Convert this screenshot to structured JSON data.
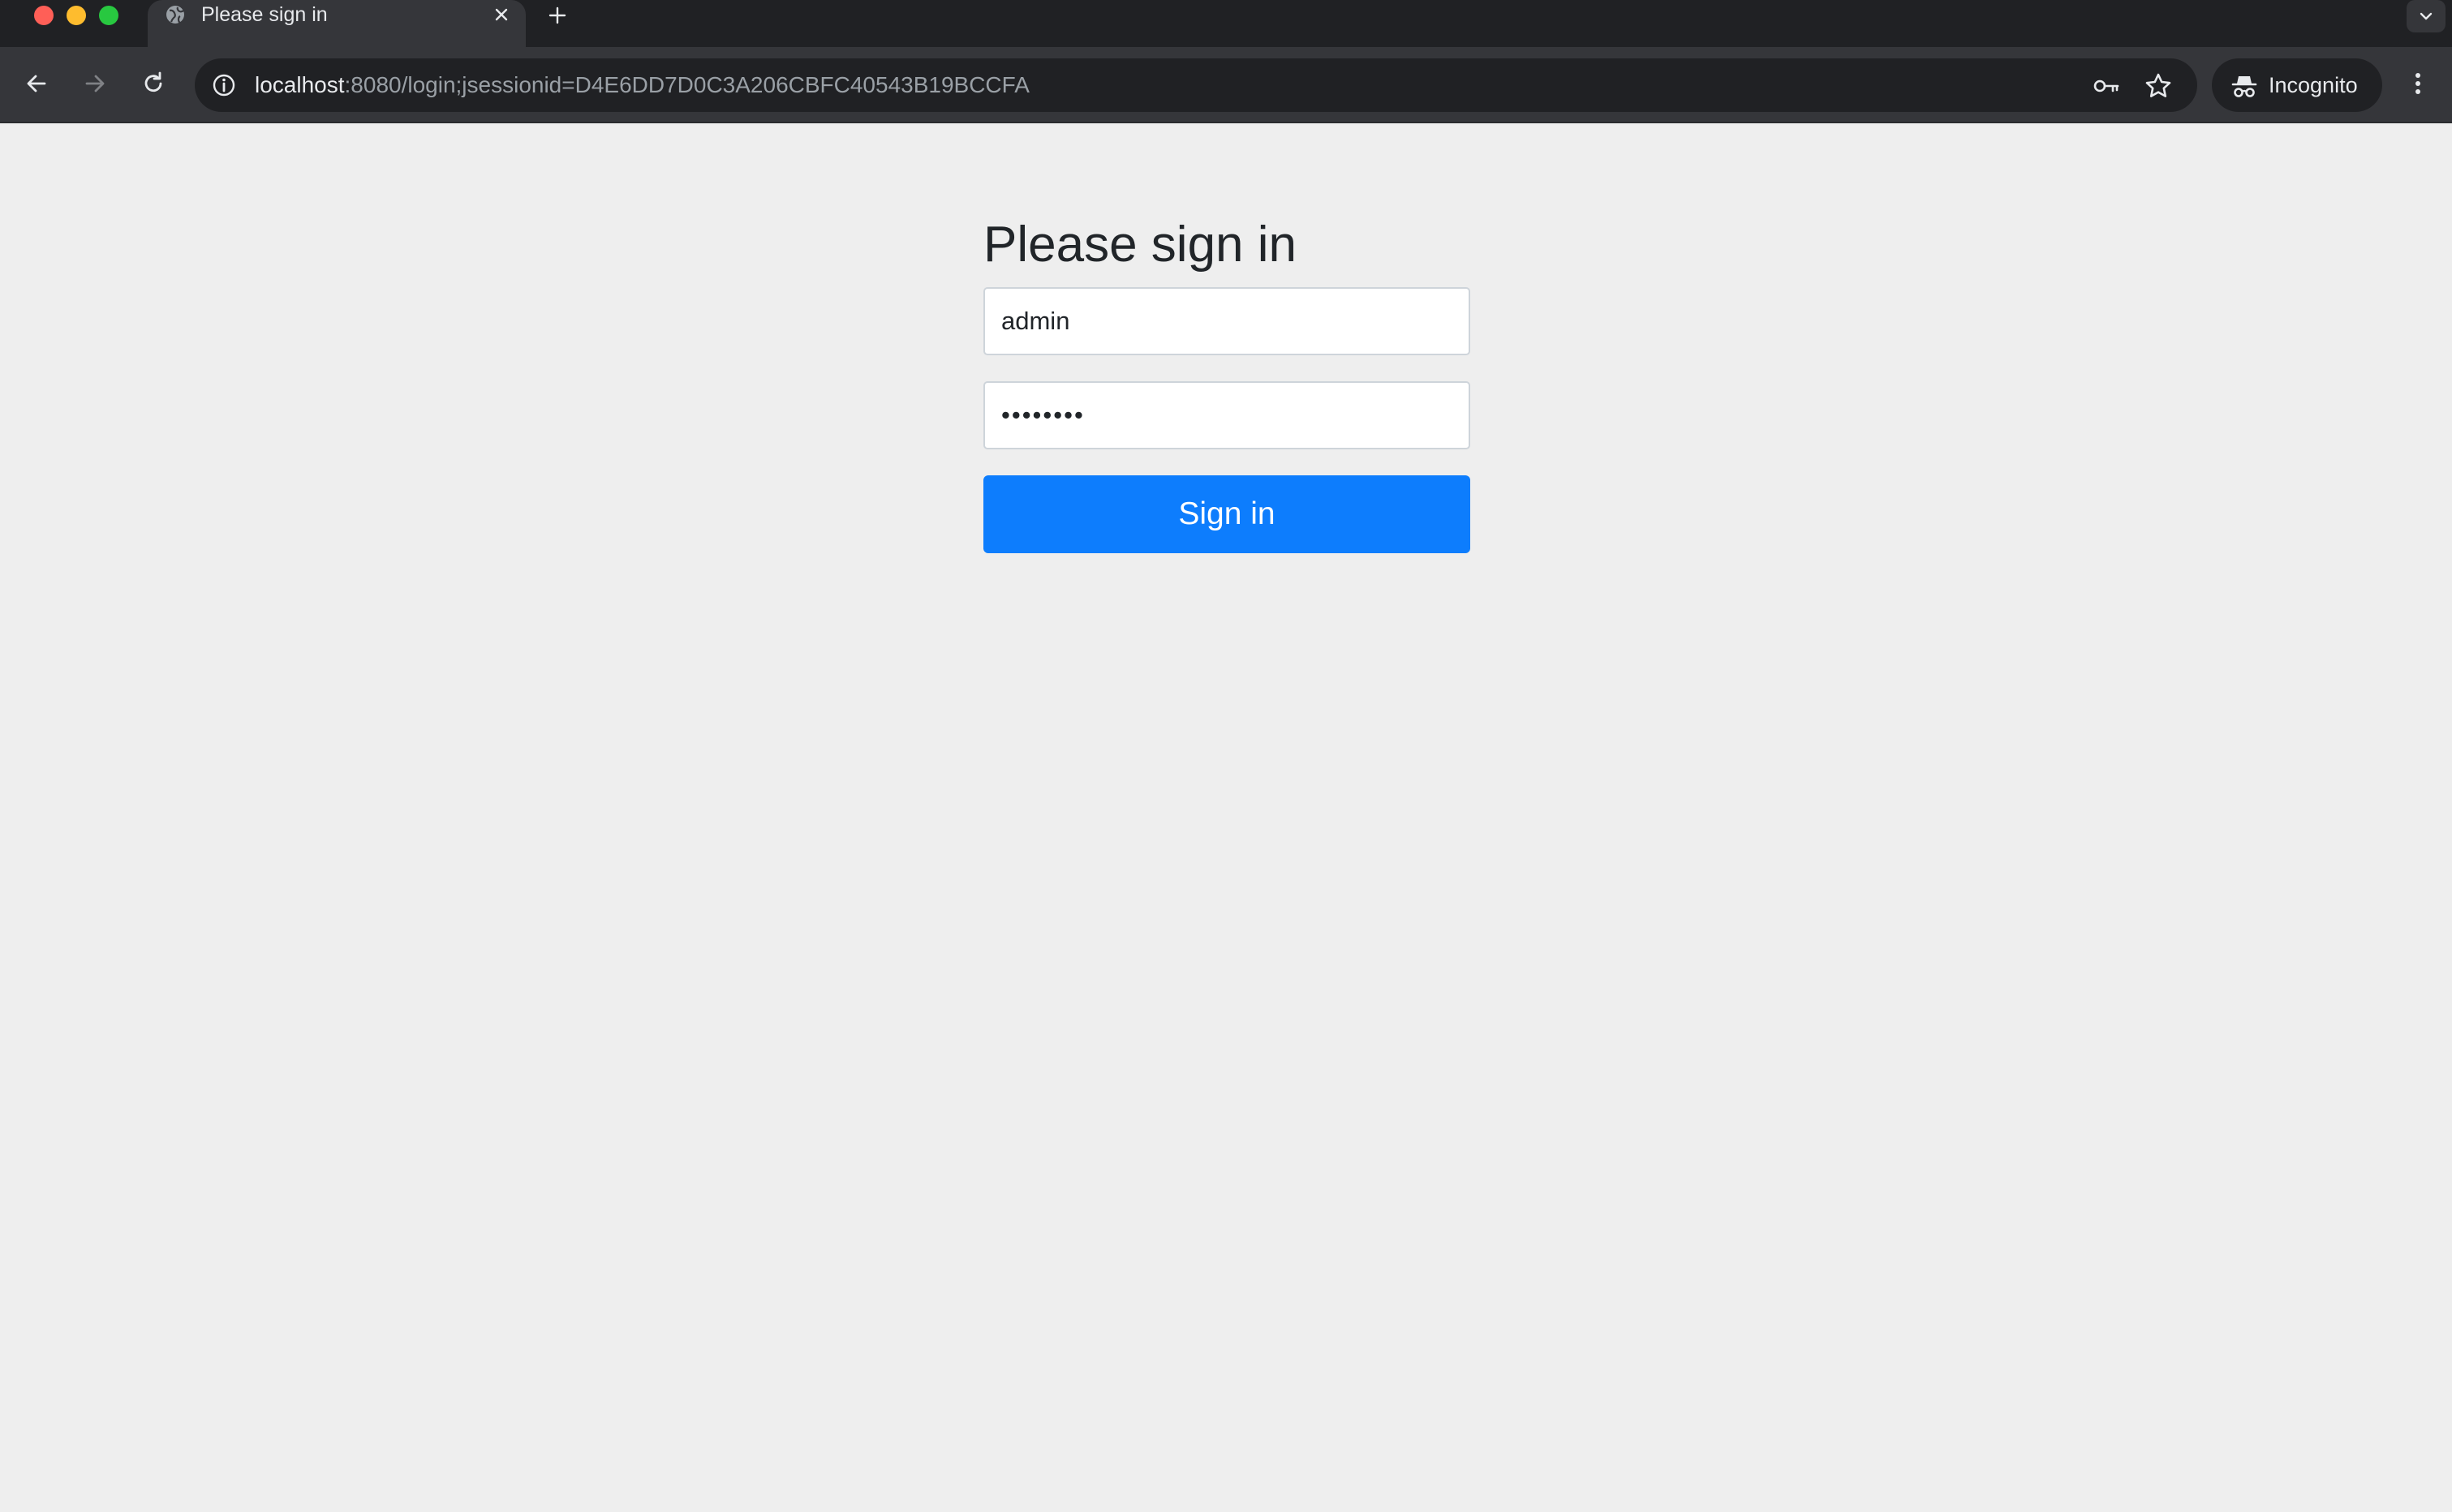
{
  "browser": {
    "tab": {
      "title": "Please sign in"
    },
    "address_bar": {
      "host": "localhost",
      "rest": ":8080/login;jsessionid=D4E6DD7D0C3A206CBFC40543B19BCCFA"
    },
    "incognito_label": "Incognito"
  },
  "login": {
    "heading": "Please sign in",
    "username_value": "admin",
    "password_value": "••••••••",
    "submit_label": "Sign in"
  },
  "icons": {
    "tab_favicon": "globe-icon",
    "tab_close": "close-icon",
    "new_tab": "plus-icon",
    "tab_list": "chevron-down-icon",
    "back": "arrow-left-icon",
    "forward": "arrow-right-icon",
    "reload": "reload-icon",
    "site_info": "info-icon",
    "password_manager": "key-icon",
    "bookmark": "star-icon",
    "incognito": "incognito-icon",
    "menu": "kebab-menu-icon"
  },
  "colors": {
    "primary_button": "#0d7dfd",
    "page_background": "#eeeeee",
    "browser_frame": "#202124",
    "toolbar": "#35363a"
  }
}
